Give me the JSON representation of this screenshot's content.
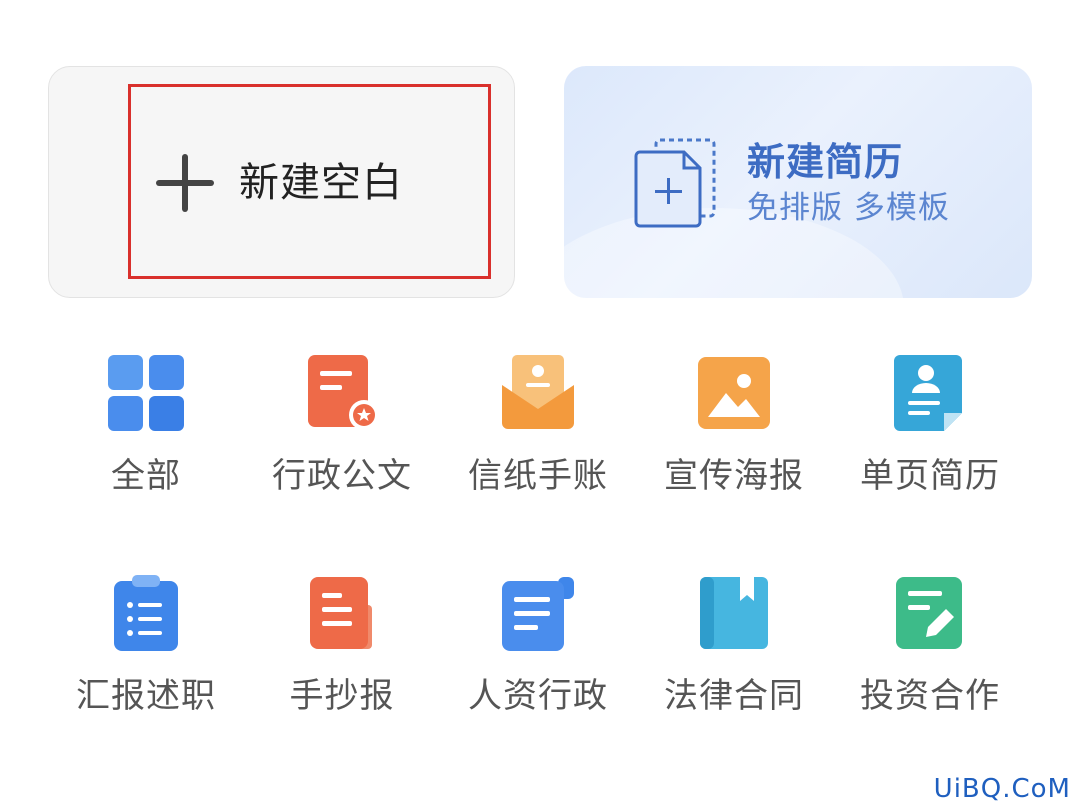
{
  "new_blank": {
    "label": "新建空白"
  },
  "new_resume": {
    "title": "新建简历",
    "subtitle": "免排版 多模板"
  },
  "categories": [
    {
      "label": "全部",
      "icon": "grid-icon"
    },
    {
      "label": "行政公文",
      "icon": "official-document-icon"
    },
    {
      "label": "信纸手账",
      "icon": "letter-envelope-icon"
    },
    {
      "label": "宣传海报",
      "icon": "poster-image-icon"
    },
    {
      "label": "单页简历",
      "icon": "resume-person-icon"
    },
    {
      "label": "汇报述职",
      "icon": "clipboard-list-icon"
    },
    {
      "label": "手抄报",
      "icon": "handwritten-paper-icon"
    },
    {
      "label": "人资行政",
      "icon": "scroll-document-icon"
    },
    {
      "label": "法律合同",
      "icon": "bookmark-book-icon"
    },
    {
      "label": "投资合作",
      "icon": "edit-document-icon"
    }
  ],
  "watermark": "UiBQ.CoM",
  "colors": {
    "highlight_border": "#d9302c",
    "resume_accent": "#3d6cc3",
    "blue_icon": "#3f86ea",
    "orange_icon": "#ee6a48",
    "amber_icon": "#f5a44a",
    "green_icon": "#3dbb89"
  }
}
